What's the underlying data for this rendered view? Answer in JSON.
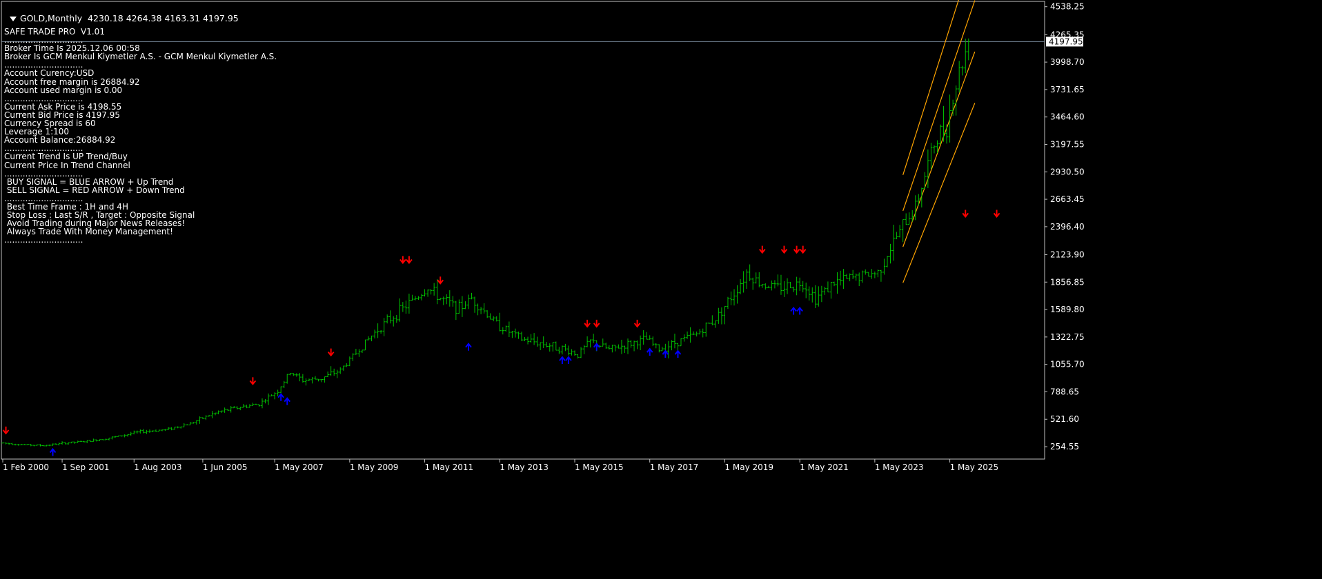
{
  "header": {
    "symbol": "GOLD,Monthly",
    "ohlc": "4230.18 4264.38 4163.31 4197.95"
  },
  "info_panel": {
    "title": "SAFE TRADE PRO  V1.01",
    "lines": [
      "..............................",
      "Broker Time Is 2025.12.06 00:58",
      "Broker Is GCM Menkul Kiymetler A.S. - GCM Menkul Kiymetler A.S.",
      "..............................",
      "Account Curency:USD",
      "Account free margin is 26884.92",
      "Account used margin is 0.00",
      "..............................",
      "Current Ask Price is 4198.55",
      "Current Bid Price is 4197.95",
      "Currency Spread is 60",
      "Leverage 1:100",
      "Account Balance:26884.92",
      "..............................",
      "Current Trend Is UP Trend/Buy",
      "Current Price In Trend Channel",
      "..............................",
      " BUY SIGNAL = BLUE ARROW + Up Trend",
      " SELL SIGNAL = RED ARROW + Down Trend",
      "..............................",
      " Best Time Frame : 1H and 4H",
      " Stop Loss : Last S/R , Target : Opposite Signal",
      " Avoid Trading during Major News Releases!",
      " Always Trade With Money Management!",
      ".............................."
    ]
  },
  "chart_data": {
    "type": "ohlc",
    "symbol": "GOLD",
    "timeframe": "Monthly",
    "current_price": 4197.95,
    "current_price_label": "4197.95",
    "ylim": [
      134.0,
      4590.0
    ],
    "y_ticks": [
      "4538.25",
      "4265.35",
      "3998.70",
      "3731.65",
      "3464.60",
      "3197.55",
      "2930.50",
      "2663.45",
      "2396.40",
      "2123.90",
      "1856.85",
      "1589.80",
      "1322.75",
      "1055.70",
      "788.65",
      "521.60",
      "254.55"
    ],
    "y_tick_values": [
      4538.25,
      4265.35,
      3998.7,
      3731.65,
      3464.6,
      3197.55,
      2930.5,
      2663.45,
      2396.4,
      2123.9,
      1856.85,
      1589.8,
      1322.75,
      1055.7,
      788.65,
      521.6,
      254.55
    ],
    "x_ticks": [
      "1 Feb 2000",
      "1 Sep 2001",
      "1 Aug 2003",
      "1 Jun 2005",
      "1 May 2007",
      "1 May 2009",
      "1 May 2011",
      "1 May 2013",
      "1 May 2015",
      "1 May 2017",
      "1 May 2019",
      "1 May 2021",
      "1 May 2023",
      "1 May 2025"
    ],
    "x_tick_months": [
      0,
      19,
      42,
      64,
      87,
      111,
      135,
      159,
      183,
      207,
      231,
      255,
      279,
      303
    ],
    "price_anchors": [
      [
        0,
        290
      ],
      [
        6,
        275
      ],
      [
        13,
        265
      ],
      [
        20,
        290
      ],
      [
        28,
        310
      ],
      [
        36,
        350
      ],
      [
        44,
        400
      ],
      [
        52,
        420
      ],
      [
        60,
        480
      ],
      [
        66,
        560
      ],
      [
        70,
        600
      ],
      [
        76,
        640
      ],
      [
        82,
        670
      ],
      [
        88,
        800
      ],
      [
        92,
        980
      ],
      [
        96,
        900
      ],
      [
        102,
        920
      ],
      [
        108,
        1000
      ],
      [
        114,
        1200
      ],
      [
        120,
        1400
      ],
      [
        128,
        1600
      ],
      [
        136,
        1800
      ],
      [
        140,
        1700
      ],
      [
        146,
        1600
      ],
      [
        150,
        1700
      ],
      [
        158,
        1450
      ],
      [
        166,
        1300
      ],
      [
        174,
        1250
      ],
      [
        180,
        1200
      ],
      [
        184,
        1150
      ],
      [
        188,
        1280
      ],
      [
        194,
        1200
      ],
      [
        200,
        1250
      ],
      [
        206,
        1300
      ],
      [
        210,
        1200
      ],
      [
        216,
        1280
      ],
      [
        222,
        1350
      ],
      [
        228,
        1500
      ],
      [
        234,
        1750
      ],
      [
        238,
        1950
      ],
      [
        242,
        1850
      ],
      [
        248,
        1800
      ],
      [
        256,
        1850
      ],
      [
        260,
        1700
      ],
      [
        266,
        1850
      ],
      [
        272,
        1900
      ],
      [
        280,
        1950
      ],
      [
        286,
        2300
      ],
      [
        292,
        2600
      ],
      [
        298,
        3200
      ],
      [
        302,
        3400
      ],
      [
        306,
        3900
      ],
      [
        309,
        4197.95
      ]
    ],
    "sell_signal_months": [
      1,
      80,
      105,
      128,
      130,
      140,
      187,
      190,
      203,
      243,
      250,
      254,
      256,
      318,
      308
    ],
    "buy_signal_months": [
      16,
      89,
      91,
      149,
      179,
      181,
      190,
      207,
      212,
      216,
      253,
      255
    ],
    "sell_signal_prices": [
      390,
      870,
      1150,
      2050,
      2050,
      1850,
      1430,
      1430,
      1430,
      2150,
      2150,
      2150,
      2150,
      2500,
      2500
    ],
    "buy_signal_prices": [
      225,
      760,
      720,
      1250,
      1120,
      1120,
      1250,
      1200,
      1180,
      1180,
      1600,
      1600
    ],
    "channel": {
      "start_month": 288,
      "end_month": 311,
      "lines": [
        {
          "start": 2900,
          "end": 5100
        },
        {
          "start": 2550,
          "end": 4600
        },
        {
          "start": 2200,
          "end": 4100
        },
        {
          "start": 1850,
          "end": 3600
        }
      ]
    },
    "colors": {
      "background": "#000000",
      "bars": "#00c000",
      "axis": "#c0c0c0",
      "sell_arrow": "#ff0000",
      "buy_arrow": "#0000ff",
      "channel": "#ffa500",
      "price_line": "#778899"
    },
    "grid": false
  }
}
